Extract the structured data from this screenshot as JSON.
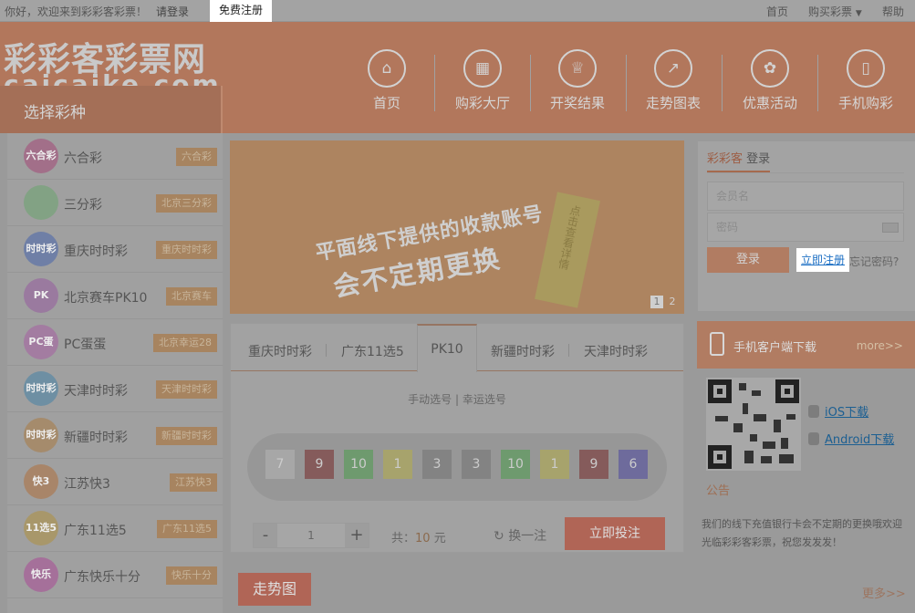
{
  "topbar": {
    "greeting": "你好，欢迎来到彩彩客彩票！",
    "login": "请登录",
    "register": "免费注册",
    "home": "首页",
    "buy": "购买彩票",
    "help": "帮助"
  },
  "logo": {
    "cn": "彩彩客彩票网",
    "en": "caicaike.com"
  },
  "select_label": "选择彩种",
  "nav": [
    {
      "label": "首页",
      "icon": "home-icon"
    },
    {
      "label": "购彩大厅",
      "icon": "store-icon"
    },
    {
      "label": "开奖结果",
      "icon": "trophy-icon"
    },
    {
      "label": "走势图表",
      "icon": "chart-icon"
    },
    {
      "label": "优惠活动",
      "icon": "gift-icon"
    },
    {
      "label": "手机购彩",
      "icon": "phone-icon"
    }
  ],
  "lotteries": [
    {
      "name": "六合彩",
      "tag": "六合彩",
      "badge": "六合彩",
      "color": "#a26f89"
    },
    {
      "name": "三分彩",
      "tag": "北京三分彩",
      "badge": "",
      "color": "#82a284"
    },
    {
      "name": "重庆时时彩",
      "tag": "重庆时时彩",
      "badge": "时时彩",
      "color": "#6f7fa6"
    },
    {
      "name": "北京赛车PK10",
      "tag": "北京赛车",
      "badge": "PK",
      "color": "#9a7a9f"
    },
    {
      "name": "PC蛋蛋",
      "tag": "北京幸运28",
      "badge": "PC蛋",
      "color": "#a37ca1"
    },
    {
      "name": "天津时时彩",
      "tag": "天津时时彩",
      "badge": "时时彩",
      "color": "#6e8fa3"
    },
    {
      "name": "新疆时时彩",
      "tag": "新疆时时彩",
      "badge": "时时彩",
      "color": "#a58b6c"
    },
    {
      "name": "江苏快3",
      "tag": "江苏快3",
      "badge": "快3",
      "color": "#a88569"
    },
    {
      "name": "广东11选5",
      "tag": "广东11选5",
      "badge": "11选5",
      "color": "#a8976a"
    },
    {
      "name": "广东快乐十分",
      "tag": "快乐十分",
      "badge": "快乐",
      "color": "#a5709a"
    }
  ],
  "banner": {
    "line1": "平面线下提供的收款账号",
    "line2": "会不定期更换",
    "card": "点击查看详情",
    "dots": [
      "1",
      "2"
    ]
  },
  "tabs": [
    "重庆时时彩",
    "广东11选5",
    "PK10",
    "新疆时时彩",
    "天津时时彩"
  ],
  "active_tab": "PK10",
  "mode": {
    "manual": "手动选号",
    "sep": " | ",
    "lucky": "幸运选号"
  },
  "numbers": [
    {
      "v": "7",
      "c": "#a7a7a7"
    },
    {
      "v": "9",
      "c": "#855b5b"
    },
    {
      "v": "10",
      "c": "#6e9a6e"
    },
    {
      "v": "1",
      "c": "#a7a36c"
    },
    {
      "v": "3",
      "c": "#838383"
    },
    {
      "v": "3",
      "c": "#838383"
    },
    {
      "v": "10",
      "c": "#6e9a6e"
    },
    {
      "v": "1",
      "c": "#a7a36c"
    },
    {
      "v": "9",
      "c": "#855b5b"
    },
    {
      "v": "6",
      "c": "#6e6b9c"
    }
  ],
  "bet": {
    "minus": "-",
    "qty": "1",
    "plus": "+",
    "total_prefix": "共：",
    "total_amount": "10",
    "total_unit": "元",
    "swap_icon": "↻",
    "swap": "换一注",
    "submit": "立即投注"
  },
  "trend": {
    "label": "走势图",
    "more": "更多>>"
  },
  "login": {
    "brand": "彩彩客",
    "title": "登录",
    "username_ph": "会员名",
    "password_ph": "密码",
    "submit": "登录",
    "register": "立即注册",
    "forgot": "忘记密码?"
  },
  "mobile": {
    "title": "手机客户端下载",
    "more": "more>>",
    "ios": "iOS下载",
    "android": "Android下载"
  },
  "notice": {
    "title": "公告",
    "text": "我们的线下充值银行卡会不定期的更换哦欢迎光临彩彩客彩票，祝您发发发！"
  }
}
